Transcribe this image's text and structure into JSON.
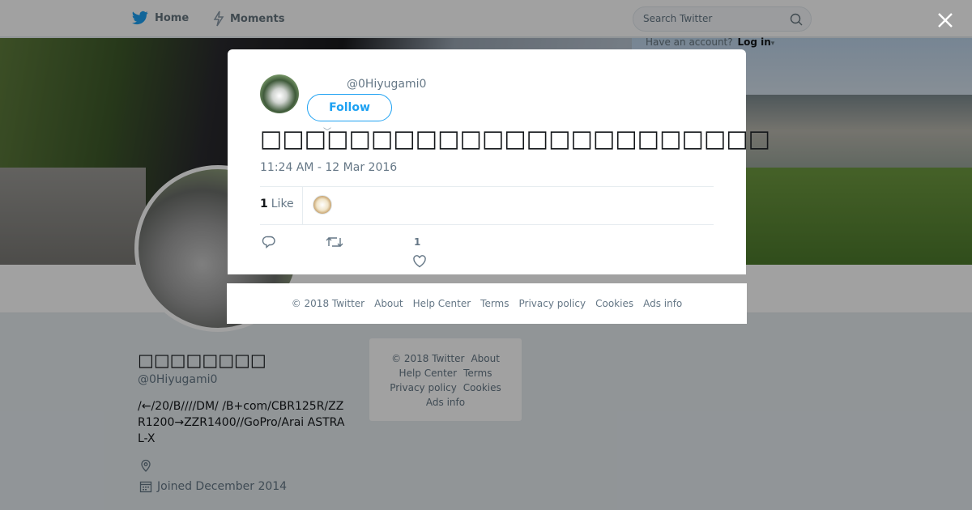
{
  "nav": {
    "home_label": "Home",
    "moments_label": "Moments",
    "search_placeholder": "Search Twitter",
    "have_account": "Have an account?",
    "login_label": "Log in"
  },
  "profile": {
    "name": "□□□□□□□□",
    "handle": "@0Hiyugami0",
    "bio": "/←/20/B////DM/ /B+com/CBR125R/ZZR1200→ZZR1400//GoPro/Arai ASTRAL-X",
    "joined": "Joined December 2014"
  },
  "side_footer": {
    "copyright": "© 2018 Twitter",
    "about": "About",
    "help": "Help Center",
    "terms": "Terms",
    "privacy": "Privacy policy",
    "cookies": "Cookies",
    "ads": "Ads info"
  },
  "tweet": {
    "handle": "@0Hiyugami0",
    "follow_label": "Follow",
    "text": "□□□□□□□□□□□□□□□□□□□□□□□",
    "timestamp": "11:24 AM - 12 Mar 2016",
    "like_count": "1",
    "like_label": "Like",
    "action_like_count": "1"
  },
  "modal_footer": {
    "copyright": "© 2018 Twitter",
    "about": "About",
    "help": "Help Center",
    "terms": "Terms",
    "privacy": "Privacy policy",
    "cookies": "Cookies",
    "ads": "Ads info"
  },
  "colors": {
    "accent": "#1da1f2",
    "muted": "#657786",
    "overlay": "rgba(0,0,0,0.37)"
  }
}
